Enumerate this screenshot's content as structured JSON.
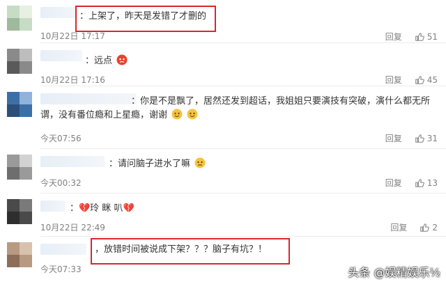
{
  "reply_label": "回复",
  "like_icon": "thumbs-up-icon",
  "comments": [
    {
      "text": "：上架了，昨天是发错了才删的",
      "time": "10月22日 17:17",
      "likes": "51",
      "highlighted": true
    },
    {
      "text": "：远点",
      "emoji": "angry-face-icon",
      "time": "10月22日 17:16",
      "likes": "45"
    },
    {
      "text": "：你是不是飘了，居然还发到超话，我姐姐只要演技有突破，演什么都无所谓，没有番位瘾和上星瘾，谢谢",
      "emoji": "smiling-face-icon",
      "time": "今天07:56",
      "likes": "31"
    },
    {
      "text": "：请问脑子进水了嘛",
      "emoji": "confused-face-icon",
      "time": "今天00:32",
      "likes": "13"
    },
    {
      "text": "：💔玲 眯 叭💔",
      "time": "10月22日 22:49",
      "likes": "2"
    },
    {
      "text": "，放错时间被说成下架？？？脑子有坑？！",
      "time": "今天07:33",
      "highlighted": true
    }
  ],
  "watermark": "头条 @娱精娱乐⅟₂",
  "colors": {
    "highlight_border": "#d9262b",
    "meta_text": "#808080"
  }
}
